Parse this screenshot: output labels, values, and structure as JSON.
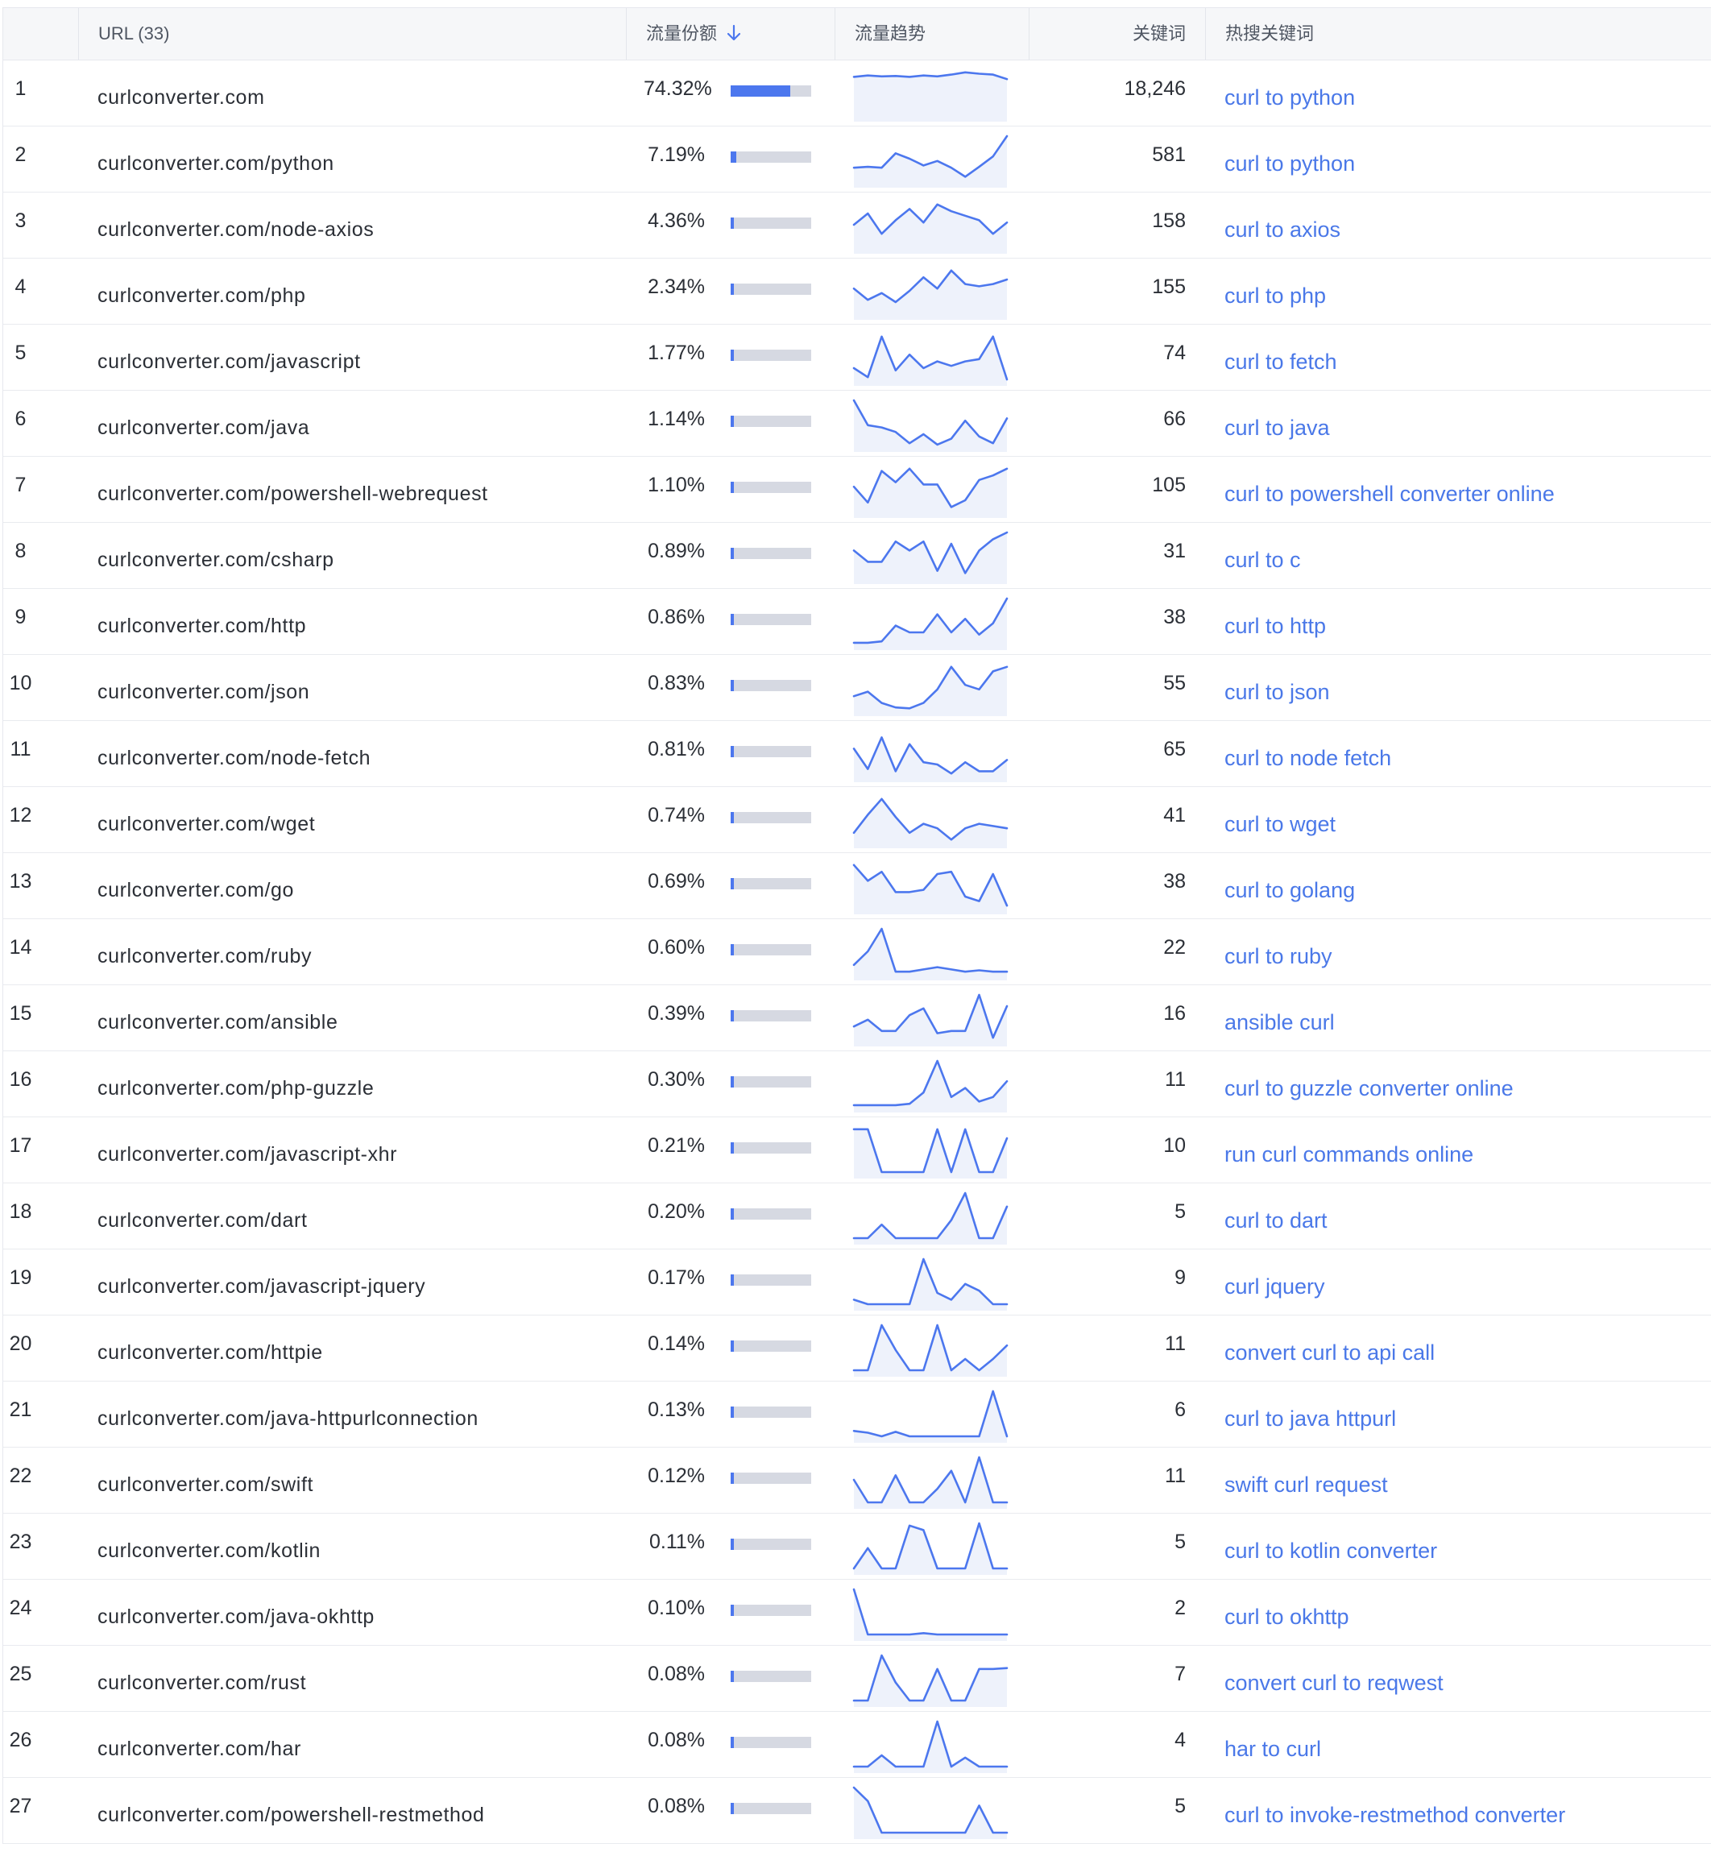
{
  "header": {
    "index_label": "",
    "url_label": "URL (33)",
    "share_label": "流量份额",
    "trend_label": "流量趋势",
    "keywords_label": "关键词",
    "hot_label": "热搜关键词"
  },
  "colors": {
    "accent": "#4c77ee",
    "link": "#4a78e8",
    "bar_track": "#d6d9e2"
  },
  "icons": {
    "sort": "arrow-down-icon"
  },
  "rows": [
    {
      "idx": "1",
      "url": "curlconverter.com",
      "share": "74.32%",
      "share_value": 74.32,
      "keywords": "18,246",
      "hot": "curl to python",
      "trend": [
        0.85,
        0.88,
        0.86,
        0.87,
        0.85,
        0.88,
        0.86,
        0.9,
        0.95,
        0.92,
        0.9,
        0.8
      ]
    },
    {
      "idx": "2",
      "url": "curlconverter.com/python",
      "share": "7.19%",
      "share_value": 7.19,
      "keywords": "581",
      "hot": "curl to python",
      "trend": [
        0.3,
        0.32,
        0.3,
        0.62,
        0.5,
        0.35,
        0.45,
        0.3,
        0.1,
        0.32,
        0.55,
        1.0
      ]
    },
    {
      "idx": "3",
      "url": "curlconverter.com/node-axios",
      "share": "4.36%",
      "share_value": 4.36,
      "keywords": "158",
      "hot": "curl to axios",
      "trend": [
        0.5,
        0.75,
        0.3,
        0.6,
        0.85,
        0.55,
        0.95,
        0.8,
        0.7,
        0.6,
        0.3,
        0.55
      ]
    },
    {
      "idx": "4",
      "url": "curlconverter.com/php",
      "share": "2.34%",
      "share_value": 2.34,
      "keywords": "155",
      "hot": "curl to php",
      "trend": [
        0.55,
        0.3,
        0.45,
        0.25,
        0.5,
        0.8,
        0.55,
        0.95,
        0.65,
        0.6,
        0.65,
        0.75
      ]
    },
    {
      "idx": "5",
      "url": "curlconverter.com/javascript",
      "share": "1.77%",
      "share_value": 1.77,
      "keywords": "74",
      "hot": "curl to fetch",
      "trend": [
        0.25,
        0.05,
        0.95,
        0.2,
        0.55,
        0.25,
        0.4,
        0.3,
        0.4,
        0.45,
        0.95,
        0.0
      ]
    },
    {
      "idx": "6",
      "url": "curlconverter.com/java",
      "share": "1.14%",
      "share_value": 1.14,
      "keywords": "66",
      "hot": "curl to java",
      "trend": [
        1.0,
        0.45,
        0.4,
        0.3,
        0.05,
        0.25,
        0.02,
        0.15,
        0.55,
        0.2,
        0.05,
        0.6
      ]
    },
    {
      "idx": "7",
      "url": "curlconverter.com/powershell-webrequest",
      "share": "1.10%",
      "share_value": 1.1,
      "keywords": "105",
      "hot": "curl to powershell converter online",
      "trend": [
        0.55,
        0.2,
        0.9,
        0.65,
        0.95,
        0.6,
        0.6,
        0.1,
        0.25,
        0.7,
        0.8,
        0.95
      ]
    },
    {
      "idx": "8",
      "url": "curlconverter.com/csharp",
      "share": "0.89%",
      "share_value": 0.89,
      "keywords": "31",
      "hot": "curl to c",
      "trend": [
        0.6,
        0.35,
        0.35,
        0.8,
        0.6,
        0.8,
        0.15,
        0.75,
        0.1,
        0.6,
        0.85,
        1.0
      ]
    },
    {
      "idx": "9",
      "url": "curlconverter.com/http",
      "share": "0.86%",
      "share_value": 0.86,
      "keywords": "38",
      "hot": "curl to http",
      "trend": [
        0.02,
        0.02,
        0.05,
        0.4,
        0.25,
        0.25,
        0.65,
        0.25,
        0.55,
        0.2,
        0.45,
        1.0
      ]
    },
    {
      "idx": "10",
      "url": "curlconverter.com/json",
      "share": "0.83%",
      "share_value": 0.83,
      "keywords": "55",
      "hot": "curl to json",
      "trend": [
        0.3,
        0.4,
        0.15,
        0.05,
        0.03,
        0.15,
        0.45,
        0.95,
        0.55,
        0.45,
        0.85,
        0.95
      ]
    },
    {
      "idx": "11",
      "url": "curlconverter.com/node-fetch",
      "share": "0.81%",
      "share_value": 0.81,
      "keywords": "65",
      "hot": "curl to node fetch",
      "trend": [
        0.6,
        0.15,
        0.85,
        0.1,
        0.7,
        0.3,
        0.25,
        0.05,
        0.3,
        0.1,
        0.1,
        0.35
      ]
    },
    {
      "idx": "12",
      "url": "curlconverter.com/wget",
      "share": "0.74%",
      "share_value": 0.74,
      "keywords": "41",
      "hot": "curl to wget",
      "trend": [
        0.2,
        0.6,
        0.95,
        0.55,
        0.2,
        0.4,
        0.3,
        0.05,
        0.3,
        0.4,
        0.35,
        0.3
      ]
    },
    {
      "idx": "13",
      "url": "curlconverter.com/go",
      "share": "0.69%",
      "share_value": 0.69,
      "keywords": "38",
      "hot": "curl to golang",
      "trend": [
        0.95,
        0.6,
        0.8,
        0.35,
        0.35,
        0.4,
        0.75,
        0.8,
        0.25,
        0.15,
        0.75,
        0.05
      ]
    },
    {
      "idx": "14",
      "url": "curlconverter.com/ruby",
      "share": "0.60%",
      "share_value": 0.6,
      "keywords": "22",
      "hot": "curl to ruby",
      "trend": [
        0.2,
        0.5,
        1.0,
        0.05,
        0.05,
        0.1,
        0.15,
        0.1,
        0.05,
        0.08,
        0.05,
        0.05
      ]
    },
    {
      "idx": "15",
      "url": "curlconverter.com/ansible",
      "share": "0.39%",
      "share_value": 0.39,
      "keywords": "16",
      "hot": "ansible curl",
      "trend": [
        0.3,
        0.45,
        0.2,
        0.2,
        0.55,
        0.7,
        0.15,
        0.2,
        0.2,
        1.0,
        0.05,
        0.75
      ]
    },
    {
      "idx": "16",
      "url": "curlconverter.com/php-guzzle",
      "share": "0.30%",
      "share_value": 0.3,
      "keywords": "11",
      "hot": "curl to guzzle converter online",
      "trend": [
        0.02,
        0.02,
        0.02,
        0.02,
        0.05,
        0.3,
        1.0,
        0.2,
        0.4,
        0.1,
        0.2,
        0.55
      ]
    },
    {
      "idx": "17",
      "url": "curlconverter.com/javascript-xhr",
      "share": "0.21%",
      "share_value": 0.21,
      "keywords": "10",
      "hot": "run curl commands online",
      "trend": [
        0.95,
        0.95,
        0.0,
        0.0,
        0.0,
        0.0,
        0.95,
        0.0,
        0.95,
        0.0,
        0.0,
        0.75
      ]
    },
    {
      "idx": "18",
      "url": "curlconverter.com/dart",
      "share": "0.20%",
      "share_value": 0.2,
      "keywords": "5",
      "hot": "curl to dart",
      "trend": [
        0.0,
        0.0,
        0.3,
        0.0,
        0.0,
        0.0,
        0.0,
        0.4,
        1.0,
        0.0,
        0.0,
        0.7
      ]
    },
    {
      "idx": "19",
      "url": "curlconverter.com/javascript-jquery",
      "share": "0.17%",
      "share_value": 0.17,
      "keywords": "9",
      "hot": "curl jquery",
      "trend": [
        0.1,
        0.0,
        0.0,
        0.0,
        0.0,
        1.0,
        0.25,
        0.1,
        0.45,
        0.3,
        0.0,
        0.0
      ]
    },
    {
      "idx": "20",
      "url": "curlconverter.com/httpie",
      "share": "0.14%",
      "share_value": 0.14,
      "keywords": "11",
      "hot": "convert curl to api call",
      "trend": [
        0.0,
        0.0,
        1.0,
        0.45,
        0.0,
        0.0,
        1.0,
        0.0,
        0.25,
        0.0,
        0.25,
        0.55
      ]
    },
    {
      "idx": "21",
      "url": "curlconverter.com/java-httpurlconnection",
      "share": "0.13%",
      "share_value": 0.13,
      "keywords": "6",
      "hot": "curl to java httpurl",
      "trend": [
        0.12,
        0.08,
        0.0,
        0.1,
        0.0,
        0.0,
        0.0,
        0.0,
        0.0,
        0.0,
        1.0,
        0.0
      ]
    },
    {
      "idx": "22",
      "url": "curlconverter.com/swift",
      "share": "0.12%",
      "share_value": 0.12,
      "keywords": "11",
      "hot": "swift curl request",
      "trend": [
        0.5,
        0.0,
        0.0,
        0.6,
        0.0,
        0.0,
        0.3,
        0.7,
        0.0,
        1.0,
        0.0,
        0.0
      ]
    },
    {
      "idx": "23",
      "url": "curlconverter.com/kotlin",
      "share": "0.11%",
      "share_value": 0.11,
      "keywords": "5",
      "hot": "curl to kotlin converter",
      "trend": [
        0.0,
        0.45,
        0.0,
        0.0,
        0.95,
        0.85,
        0.0,
        0.0,
        0.0,
        1.0,
        0.0,
        0.0
      ]
    },
    {
      "idx": "24",
      "url": "curlconverter.com/java-okhttp",
      "share": "0.10%",
      "share_value": 0.1,
      "keywords": "2",
      "hot": "curl to okhttp",
      "trend": [
        1.0,
        0.0,
        0.0,
        0.0,
        0.0,
        0.03,
        0.0,
        0.0,
        0.0,
        0.0,
        0.0,
        0.0
      ]
    },
    {
      "idx": "25",
      "url": "curlconverter.com/rust",
      "share": "0.08%",
      "share_value": 0.08,
      "keywords": "7",
      "hot": "convert curl to reqwest",
      "trend": [
        0.0,
        0.0,
        1.0,
        0.4,
        0.0,
        0.0,
        0.7,
        0.0,
        0.0,
        0.7,
        0.7,
        0.72
      ]
    },
    {
      "idx": "26",
      "url": "curlconverter.com/har",
      "share": "0.08%",
      "share_value": 0.08,
      "keywords": "4",
      "hot": "har to curl",
      "trend": [
        0.0,
        0.0,
        0.25,
        0.0,
        0.0,
        0.0,
        1.0,
        0.0,
        0.2,
        0.0,
        0.0,
        0.0
      ]
    },
    {
      "idx": "27",
      "url": "curlconverter.com/powershell-restmethod",
      "share": "0.08%",
      "share_value": 0.08,
      "keywords": "5",
      "hot": "curl to invoke-restmethod converter",
      "trend": [
        1.0,
        0.7,
        0.0,
        0.0,
        0.0,
        0.0,
        0.0,
        0.0,
        0.0,
        0.6,
        0.0,
        0.0
      ]
    }
  ]
}
